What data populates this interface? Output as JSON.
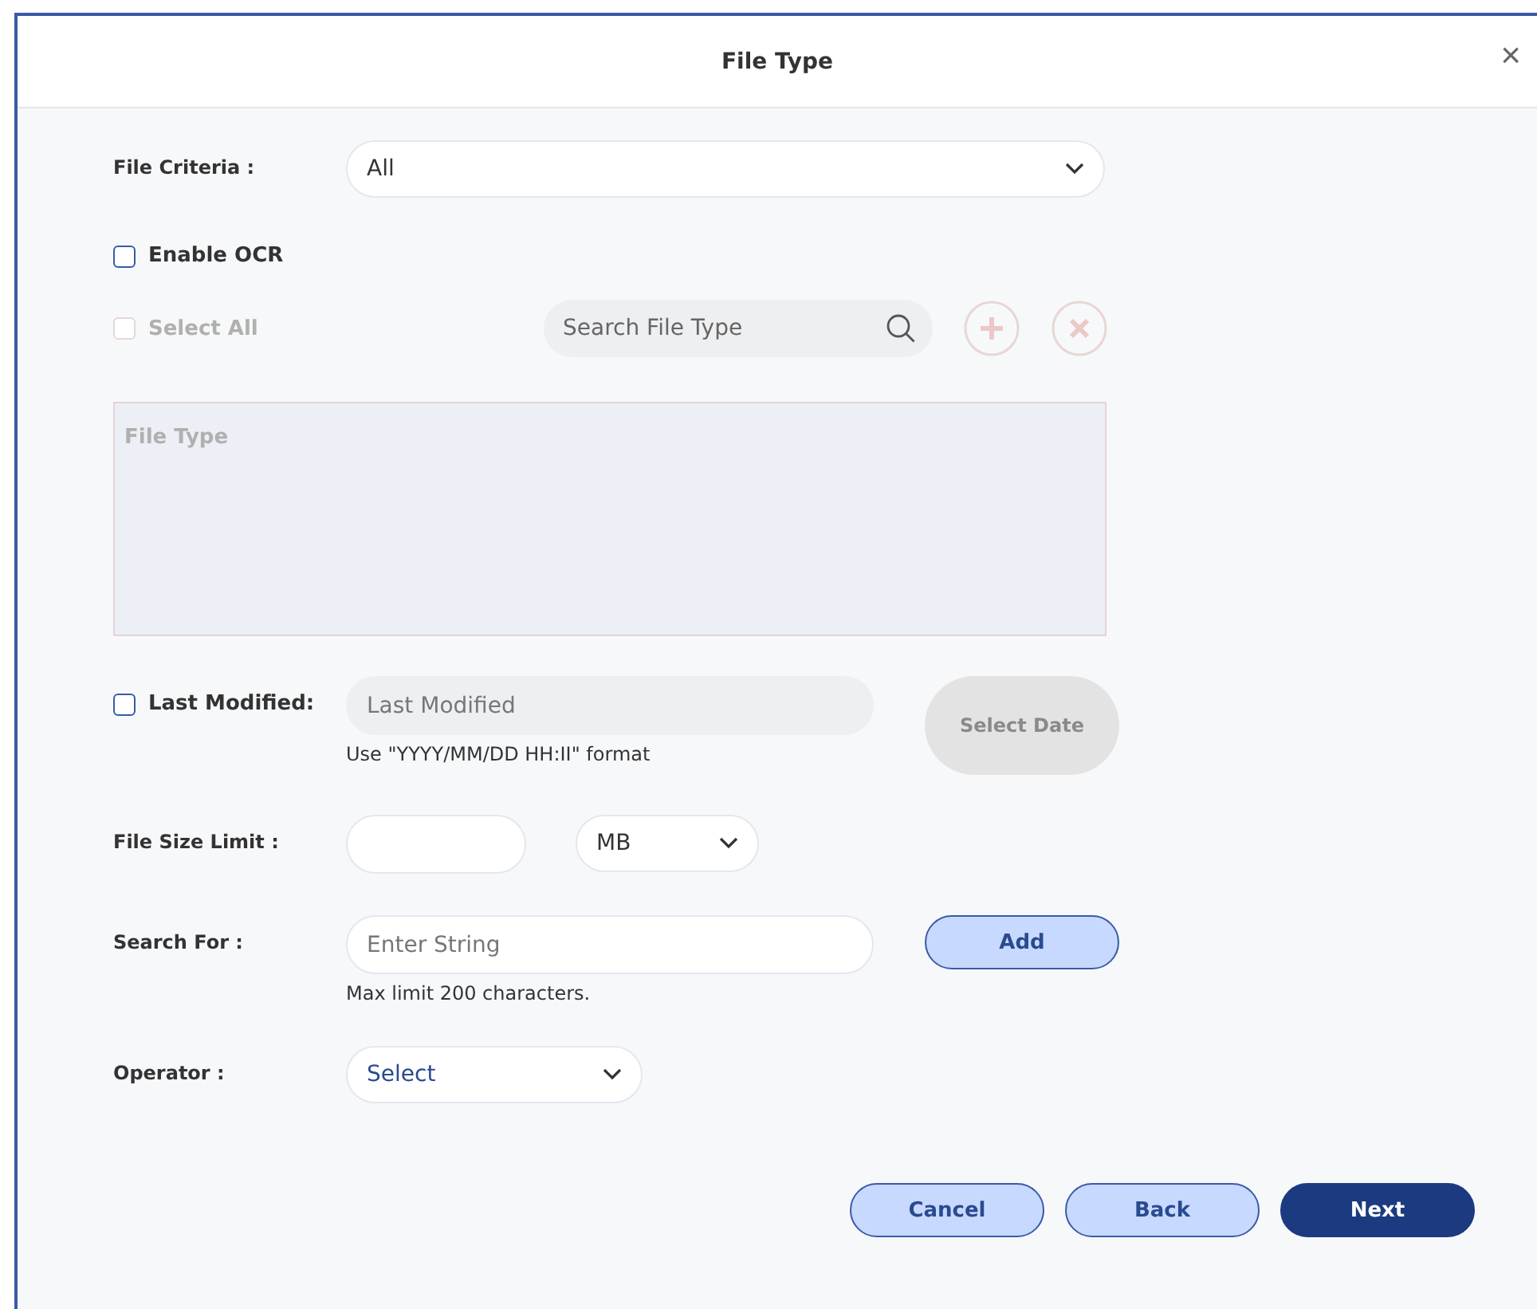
{
  "dialog": {
    "title": "File Type",
    "close": "×"
  },
  "file_criteria": {
    "label": "File Criteria :",
    "value": "All"
  },
  "enable_ocr": {
    "label": "Enable OCR",
    "checked": false
  },
  "select_all": {
    "label": "Select All",
    "checked": false,
    "disabled": true
  },
  "search": {
    "placeholder": "Search File Type"
  },
  "file_type_list": {
    "header": "File Type",
    "disabled": true
  },
  "last_modified": {
    "label": "Last Modified:",
    "checked": false,
    "placeholder": "Last Modified",
    "hint": "Use \"YYYY/MM/DD HH:II\" format",
    "button": "Select Date",
    "button_disabled": true
  },
  "file_size_limit": {
    "label": "File Size Limit :",
    "unit": "MB"
  },
  "search_for": {
    "label": "Search For :",
    "placeholder": "Enter String",
    "hint": "Max limit 200 characters.",
    "button": "Add"
  },
  "operator": {
    "label": "Operator :",
    "value": "Select"
  },
  "buttons": [
    {
      "label": "Cancel",
      "kind": "secondary"
    },
    {
      "label": "Back",
      "kind": "secondary"
    },
    {
      "label": "Next",
      "kind": "primary"
    }
  ]
}
